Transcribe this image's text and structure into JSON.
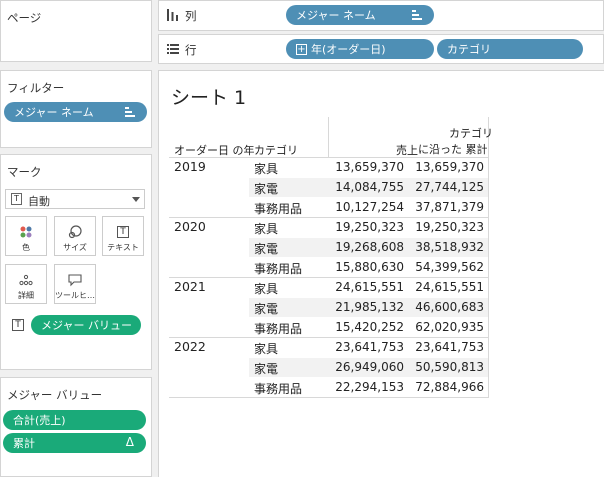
{
  "left": {
    "pages_label": "ページ",
    "filters_label": "フィルター",
    "filter_pill": "メジャー ネーム",
    "marks_label": "マーク",
    "mark_type": "自動",
    "mark_cards": [
      {
        "name": "color",
        "label": "色"
      },
      {
        "name": "size",
        "label": "サイズ"
      },
      {
        "name": "text",
        "label": "テキスト"
      },
      {
        "name": "detail",
        "label": "詳細"
      },
      {
        "name": "tooltip",
        "label": "ツールヒ…"
      }
    ],
    "text_pill": "メジャー バリュー",
    "measure_values_label": "メジャー バリュー",
    "measure_pills": [
      "合計(売上)",
      "累計"
    ],
    "delta_symbol": "Δ"
  },
  "shelves": {
    "columns_label": "列",
    "rows_label": "行",
    "columns_pill": "メジャー ネーム",
    "rows_pills": [
      "年(オーダー日)",
      "カテゴリ"
    ]
  },
  "sheet": {
    "title": "シート 1",
    "headers": {
      "year": "オーダー日 の年",
      "category": "カテゴリ",
      "sales": "売上",
      "cumulative_line1": "カテゴリ",
      "cumulative_line2": "に沿った 累計"
    },
    "groups": [
      {
        "year": "2019",
        "rows": [
          {
            "category": "家具",
            "sales": "13,659,370",
            "cumulative": "13,659,370"
          },
          {
            "category": "家電",
            "sales": "14,084,755",
            "cumulative": "27,744,125"
          },
          {
            "category": "事務用品",
            "sales": "10,127,254",
            "cumulative": "37,871,379"
          }
        ]
      },
      {
        "year": "2020",
        "rows": [
          {
            "category": "家具",
            "sales": "19,250,323",
            "cumulative": "19,250,323"
          },
          {
            "category": "家電",
            "sales": "19,268,608",
            "cumulative": "38,518,932"
          },
          {
            "category": "事務用品",
            "sales": "15,880,630",
            "cumulative": "54,399,562"
          }
        ]
      },
      {
        "year": "2021",
        "rows": [
          {
            "category": "家具",
            "sales": "24,615,551",
            "cumulative": "24,615,551"
          },
          {
            "category": "家電",
            "sales": "21,985,132",
            "cumulative": "46,600,683"
          },
          {
            "category": "事務用品",
            "sales": "15,420,252",
            "cumulative": "62,020,935"
          }
        ]
      },
      {
        "year": "2022",
        "rows": [
          {
            "category": "家具",
            "sales": "23,641,753",
            "cumulative": "23,641,753"
          },
          {
            "category": "家電",
            "sales": "26,949,060",
            "cumulative": "50,590,813"
          },
          {
            "category": "事務用品",
            "sales": "22,294,153",
            "cumulative": "72,884,966"
          }
        ]
      }
    ]
  },
  "colors": {
    "measure_pill": "#4e8fb5",
    "value_pill": "#1aaa79"
  }
}
